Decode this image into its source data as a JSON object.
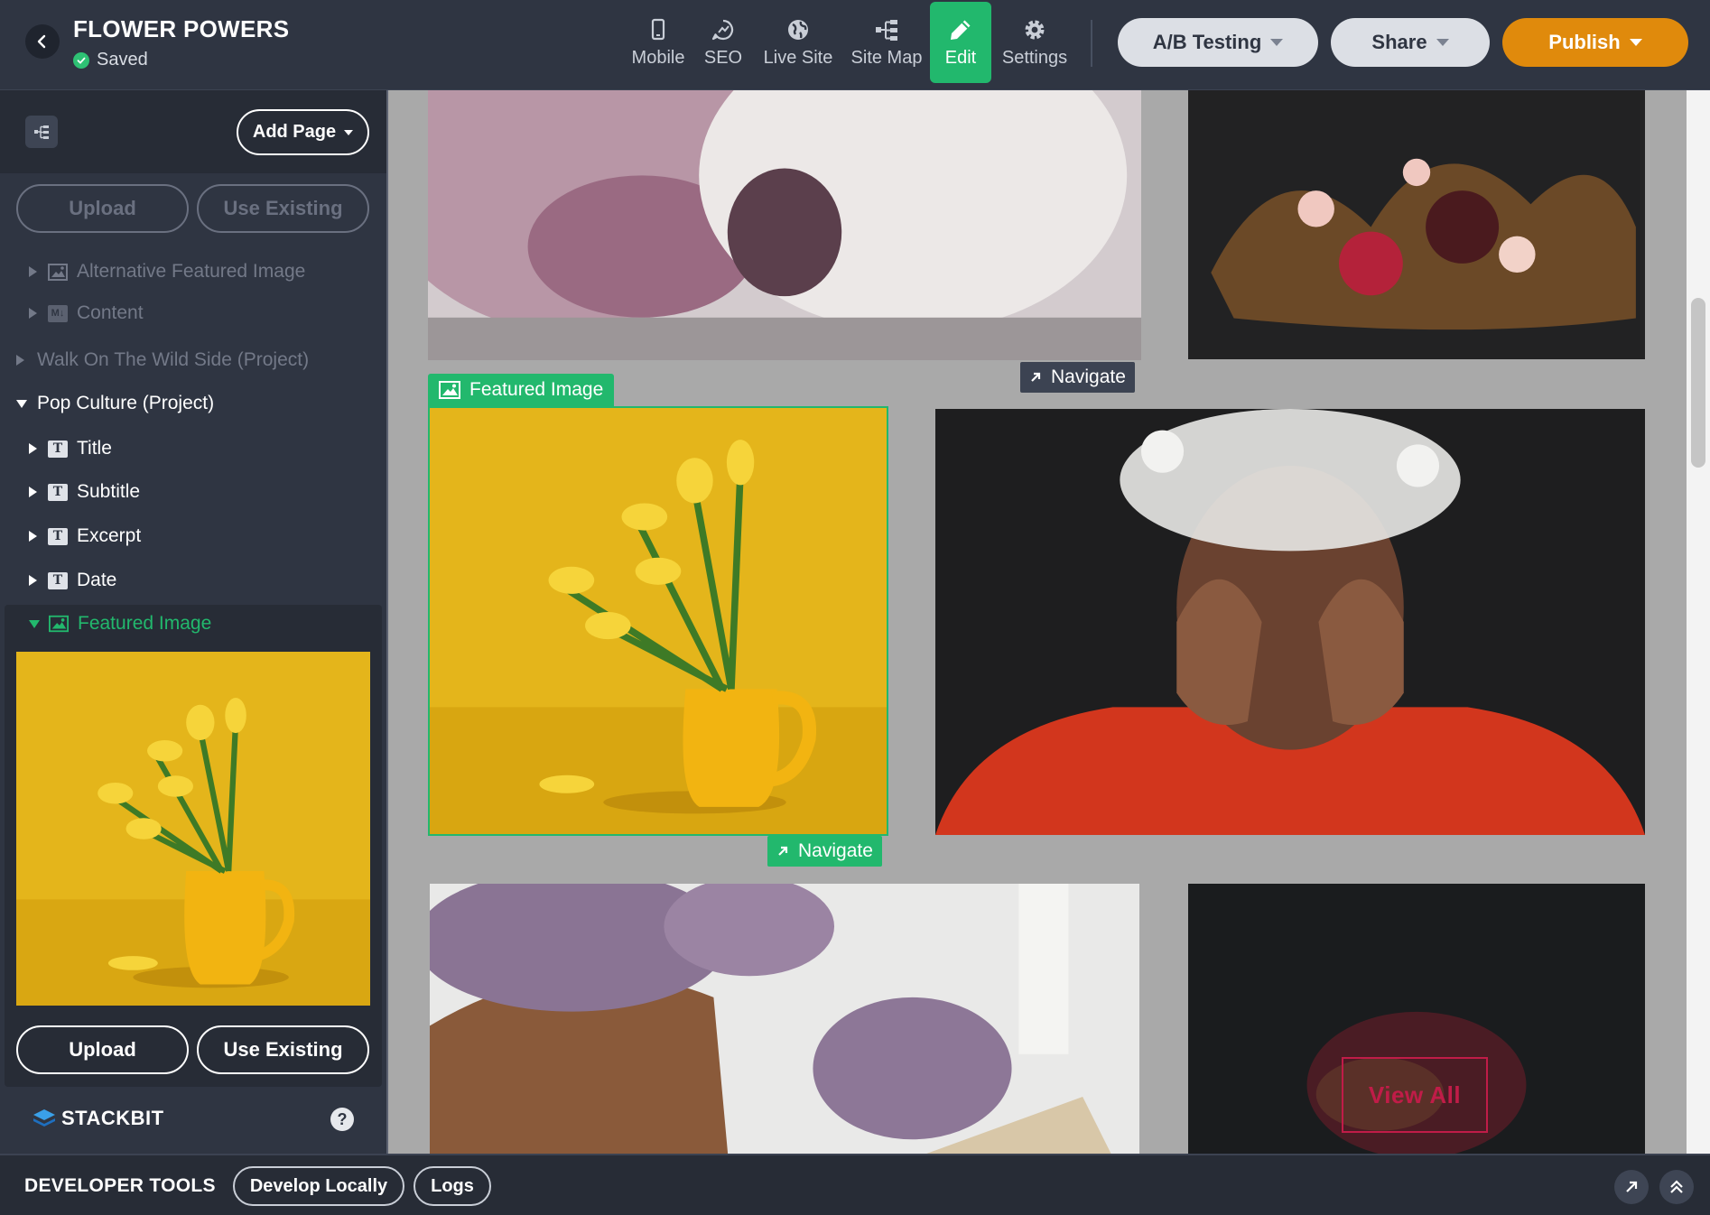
{
  "header": {
    "site_title": "FLOWER POWERS",
    "save_status": "Saved",
    "nav": [
      {
        "label": "Mobile",
        "icon": "mobile-icon"
      },
      {
        "label": "SEO",
        "icon": "seo-icon"
      },
      {
        "label": "Live Site",
        "icon": "globe-icon"
      },
      {
        "label": "Site Map",
        "icon": "sitemap-icon"
      },
      {
        "label": "Edit",
        "icon": "pencil-icon",
        "active": true
      },
      {
        "label": "Settings",
        "icon": "gear-icon"
      }
    ],
    "ab_testing": "A/B Testing",
    "share": "Share",
    "publish": "Publish"
  },
  "sidebar": {
    "add_page": "Add Page",
    "upload_top": "Upload",
    "use_existing_top": "Use Existing",
    "fields_dim": [
      {
        "label": "Alternative Featured Image",
        "icon": "image-icon"
      },
      {
        "label": "Content",
        "icon": "markdown-icon"
      }
    ],
    "project_wild": "Walk On The Wild Side (Project)",
    "project_pop": "Pop Culture (Project)",
    "fields": [
      {
        "label": "Title",
        "icon": "text-icon"
      },
      {
        "label": "Subtitle",
        "icon": "text-icon"
      },
      {
        "label": "Excerpt",
        "icon": "text-icon"
      },
      {
        "label": "Date",
        "icon": "text-icon"
      }
    ],
    "featured_image": "Featured Image",
    "upload": "Upload",
    "use_existing": "Use Existing",
    "brand": "STACKBIT",
    "help": "?"
  },
  "canvas": {
    "navigate_top": "Navigate",
    "featured_label": "Featured Image",
    "navigate_selected": "Navigate",
    "view_all": "View All"
  },
  "devtools": {
    "title": "DEVELOPER TOOLS",
    "develop_locally": "Develop Locally",
    "logs": "Logs"
  },
  "colors": {
    "topbar": "#2f3542",
    "accent_green": "#22b86d",
    "publish_orange": "#e08a0c",
    "canvas_bg": "#a9a9a9"
  }
}
